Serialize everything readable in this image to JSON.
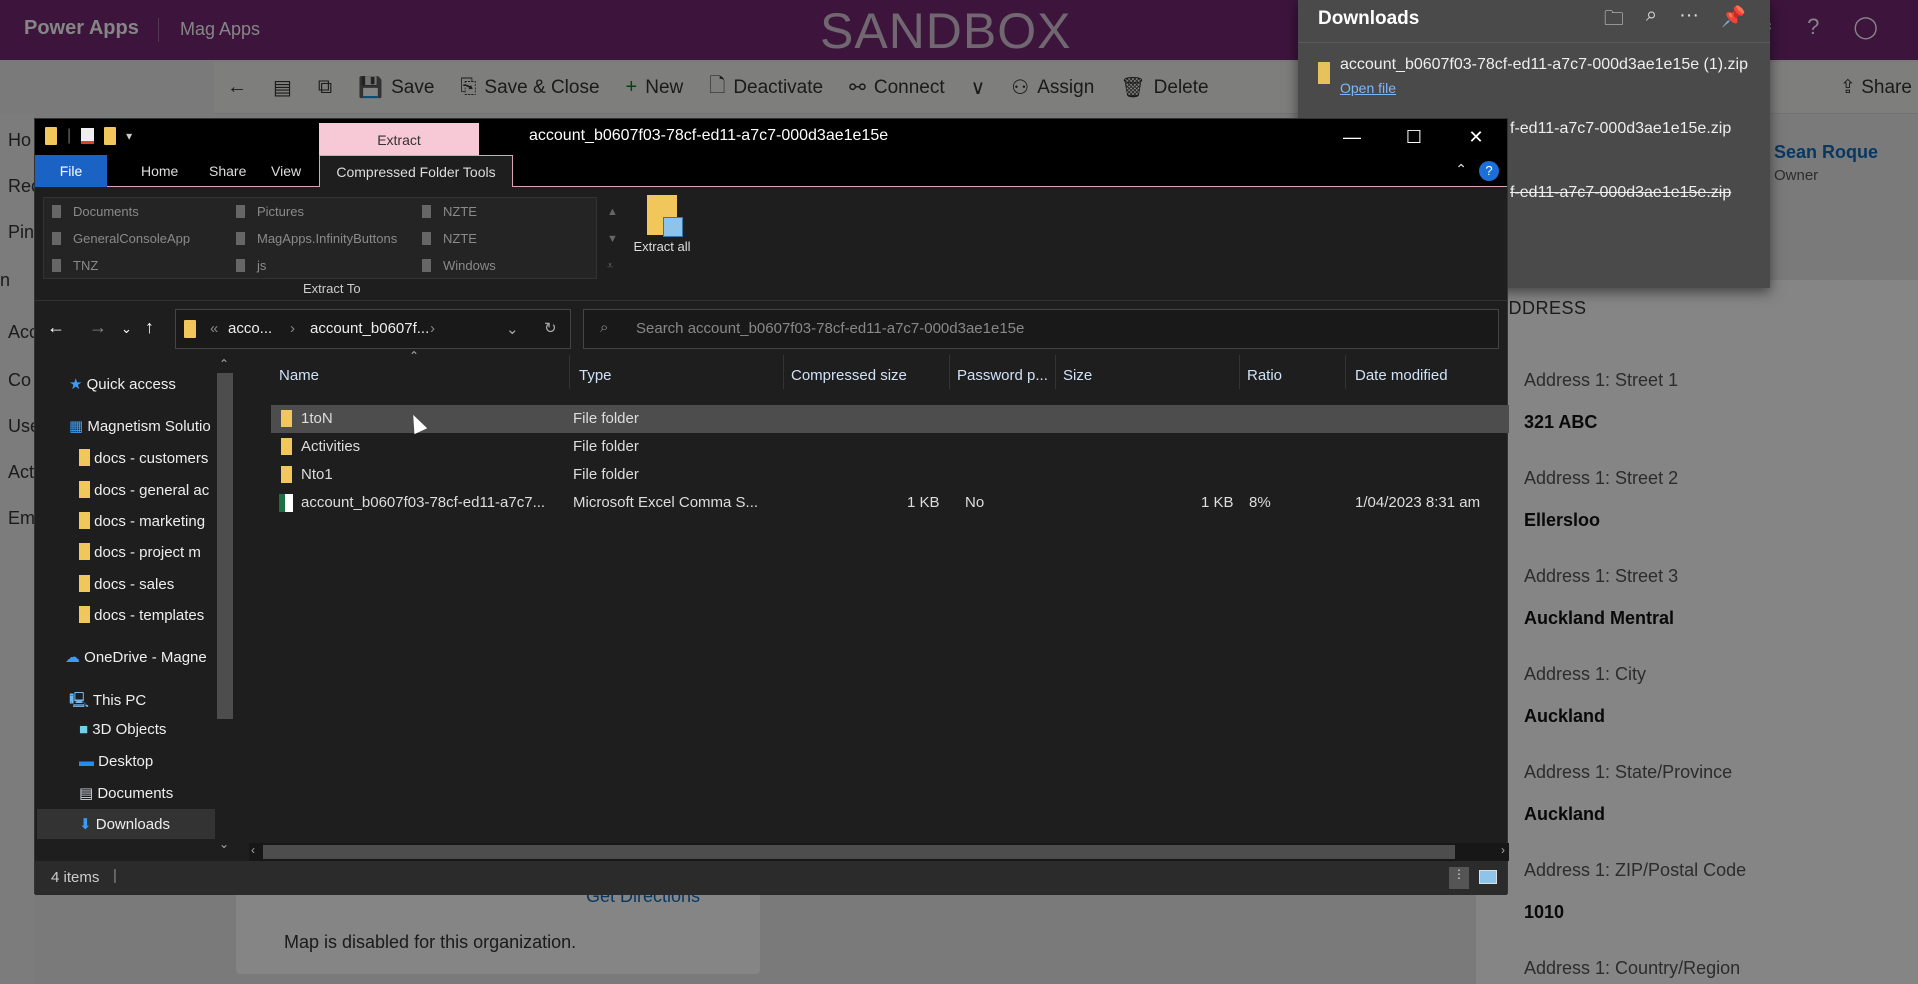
{
  "app": {
    "brand": "Power Apps",
    "name": "Mag Apps",
    "env_label": "SANDBOX"
  },
  "topbar_icons": [
    "gear-icon",
    "help-icon",
    "avatar"
  ],
  "commands": [
    {
      "icon": "←",
      "label": "",
      "name": "back-button"
    },
    {
      "icon": "▤",
      "label": "",
      "name": "form-button"
    },
    {
      "icon": "⧉",
      "label": "",
      "name": "open-new-window-button"
    },
    {
      "icon": "💾",
      "label": "Save",
      "name": "save-button"
    },
    {
      "icon": "⎘",
      "label": "Save & Close",
      "name": "save-close-button"
    },
    {
      "icon": "+",
      "label": "New",
      "name": "new-button"
    },
    {
      "icon": "🗋",
      "label": "Deactivate",
      "name": "deactivate-button"
    },
    {
      "icon": "⚯",
      "label": "Connect",
      "name": "connect-button"
    },
    {
      "icon": "∨",
      "label": "",
      "name": "connect-more-button"
    },
    {
      "icon": "⚇",
      "label": "Assign",
      "name": "assign-button"
    },
    {
      "icon": "🗑",
      "label": "Delete",
      "name": "delete-button"
    }
  ],
  "share_label": "Share",
  "leftnav": [
    "Ho",
    "Rec",
    "Pin",
    "n",
    "Acc",
    "Co",
    "Use",
    "Act",
    "Em"
  ],
  "owner": {
    "name": "Sean Roque",
    "role": "Owner"
  },
  "map": {
    "directions": "Get Directions",
    "message": "Map is disabled for this organization."
  },
  "address": {
    "header": "ADDRESS",
    "fields": [
      {
        "label": "Address 1: Street 1",
        "value": "321 ABC"
      },
      {
        "label": "Address 1: Street 2",
        "value": "Ellersloo"
      },
      {
        "label": "Address 1: Street 3",
        "value": "Auckland Mentral"
      },
      {
        "label": "Address 1: City",
        "value": "Auckland"
      },
      {
        "label": "Address 1: State/Province",
        "value": "Auckland"
      },
      {
        "label": "Address 1: ZIP/Postal Code",
        "value": "1010"
      },
      {
        "label": "Address 1: Country/Region",
        "value": ""
      }
    ]
  },
  "downloads": {
    "title": "Downloads",
    "items": [
      {
        "name": "account_b0607f03-78cf-ed11-a7c7-000d3ae1e15e (1).zip",
        "action": "Open file"
      },
      {
        "name": "f-ed11-a7c7-000d3ae1e15e.zip"
      },
      {
        "name": "f-ed11-a7c7-000d3ae1e15e.zip",
        "deleted": true
      }
    ]
  },
  "explorer": {
    "title": "account_b0607f03-78cf-ed11-a7c7-000d3ae1e15e",
    "context_tab": "Extract",
    "tabs": {
      "file": "File",
      "home": "Home",
      "share": "Share",
      "view": "View",
      "tools": "Compressed Folder Tools"
    },
    "gallery": [
      "Documents",
      "Pictures",
      "NZTE",
      "GeneralConsoleApp",
      "MagApps.InfinityButtons",
      "NZTE",
      "TNZ",
      "js",
      "Windows"
    ],
    "extract_all": "Extract all",
    "extract_to": "Extract To",
    "breadcrumb": [
      "acco...",
      "account_b0607f..."
    ],
    "search_placeholder": "Search account_b0607f03-78cf-ed11-a7c7-000d3ae1e15e",
    "nav": [
      "Quick access",
      "Magnetism Solutio",
      "docs - customers",
      "docs - general ac",
      "docs - marketing",
      "docs - project m",
      "docs - sales",
      "docs - templates",
      "OneDrive - Magne",
      "This PC",
      "3D Objects",
      "Desktop",
      "Documents",
      "Downloads"
    ],
    "columns": [
      "Name",
      "Type",
      "Compressed size",
      "Password p...",
      "Size",
      "Ratio",
      "Date modified"
    ],
    "rows": [
      {
        "name": "1toN",
        "type": "File folder",
        "csize": "",
        "pw": "",
        "size": "",
        "ratio": "",
        "date": ""
      },
      {
        "name": "Activities",
        "type": "File folder",
        "csize": "",
        "pw": "",
        "size": "",
        "ratio": "",
        "date": ""
      },
      {
        "name": "Nto1",
        "type": "File folder",
        "csize": "",
        "pw": "",
        "size": "",
        "ratio": "",
        "date": ""
      },
      {
        "name": "account_b0607f03-78cf-ed11-a7c7...",
        "type": "Microsoft Excel Comma S...",
        "csize": "1 KB",
        "pw": "No",
        "size": "1 KB",
        "ratio": "8%",
        "date": "1/04/2023 8:31 am"
      }
    ],
    "status": "4 items"
  }
}
